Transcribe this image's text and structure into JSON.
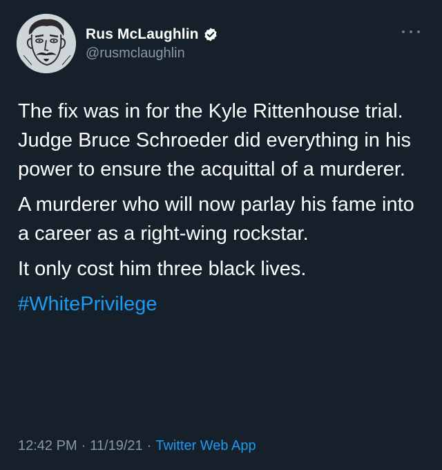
{
  "author": {
    "display_name": "Rus McLaughlin",
    "handle": "@rusmclaughlin",
    "verified": true
  },
  "tweet": {
    "paragraphs": [
      "The fix was in for the Kyle Rittenhouse trial. Judge Bruce Schroeder did everything in his power to ensure the acquittal of a murderer.",
      "A murderer who will now parlay his fame into a career as a right-wing rockstar.",
      "It only cost him three black lives."
    ],
    "hashtag": "#WhitePrivilege"
  },
  "meta": {
    "time": "12:42 PM",
    "separator": "·",
    "date": "11/19/21",
    "source": "Twitter Web App"
  },
  "icons": {
    "more": "more-options-icon",
    "verified": "verified-badge-icon",
    "avatar": "avatar-illustration"
  },
  "colors": {
    "background": "#15202b",
    "text": "#ffffff",
    "secondary": "#8b98a5",
    "accent": "#1d9bf0"
  }
}
